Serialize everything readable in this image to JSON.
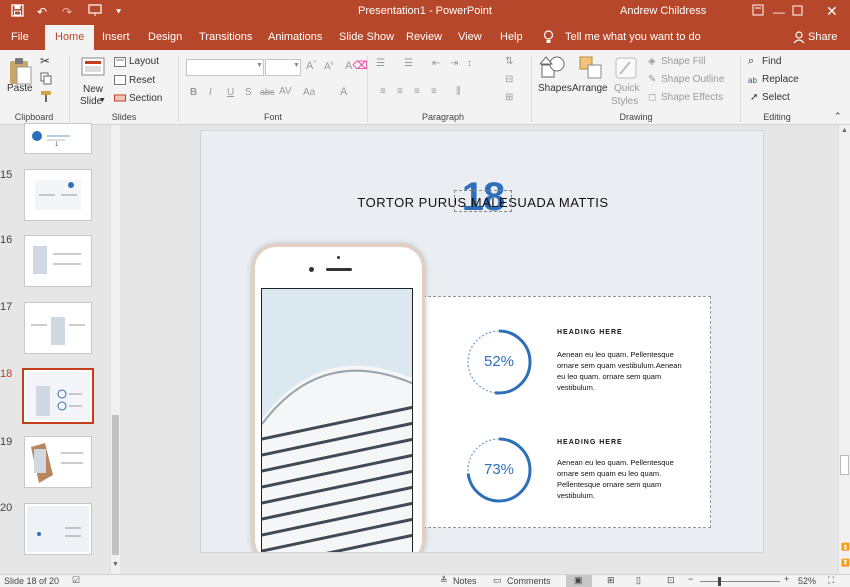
{
  "titlebar": {
    "title": "Presentation1 - PowerPoint",
    "user": "Andrew Childress",
    "icons": [
      "save-icon",
      "undo-icon",
      "redo-icon",
      "present-icon",
      "customize-icon"
    ],
    "controls": [
      "ribbon-display-icon",
      "minimize-icon",
      "maximize-icon",
      "close-icon"
    ]
  },
  "tabs": {
    "items": [
      "File",
      "Home",
      "Insert",
      "Design",
      "Transitions",
      "Animations",
      "Slide Show",
      "Review",
      "View",
      "Help"
    ],
    "active": "Home",
    "tell_me": "Tell me what you want to do",
    "share": "Share"
  },
  "ribbon": {
    "clipboard": {
      "label": "Clipboard",
      "paste": "Paste"
    },
    "slides": {
      "label": "Slides",
      "new_slide_1": "New",
      "new_slide_2": "Slide",
      "layout": "Layout",
      "reset": "Reset",
      "section": "Section"
    },
    "font": {
      "label": "Font",
      "font_name": "",
      "font_size": ""
    },
    "paragraph": {
      "label": "Paragraph"
    },
    "drawing": {
      "label": "Drawing",
      "shapes": "Shapes",
      "arrange": "Arrange",
      "quick_1": "Quick",
      "quick_2": "Styles",
      "shape_fill": "Shape Fill",
      "shape_outline": "Shape Outline",
      "shape_effects": "Shape Effects"
    },
    "editing": {
      "label": "Editing",
      "find": "Find",
      "replace": "Replace",
      "select": "Select"
    }
  },
  "thumbnails": [
    {
      "num": "",
      "partial_text": "1"
    },
    {
      "num": "15"
    },
    {
      "num": "16"
    },
    {
      "num": "17"
    },
    {
      "num": "18",
      "selected": true
    },
    {
      "num": "19"
    },
    {
      "num": "20"
    }
  ],
  "slide": {
    "bg_number": "18",
    "title": "TORTOR PURUS MALESUADA MATTIS",
    "items": [
      {
        "percent": "52%",
        "value": 0.52,
        "heading": "HEADING HERE",
        "body": "Aenean eu leo quam. Pellentesque ornare sem quam vestibulum.Aenean eu leo quam. ornare sem quam vestibulum."
      },
      {
        "percent": "73%",
        "value": 0.73,
        "heading": "HEADING HERE",
        "body": "Aenean eu leo quam. Pellentesque ornare sem quam eu leo quam. Pellentesque ornare sem quam vestibulum."
      }
    ]
  },
  "status": {
    "slide_info": "Slide 18 of 20",
    "notes": "Notes",
    "comments": "Comments",
    "zoom": "52%"
  },
  "colors": {
    "accent": "#b7472a",
    "ring": "#2e6fba",
    "selected_thumb": "#c43e1c"
  }
}
